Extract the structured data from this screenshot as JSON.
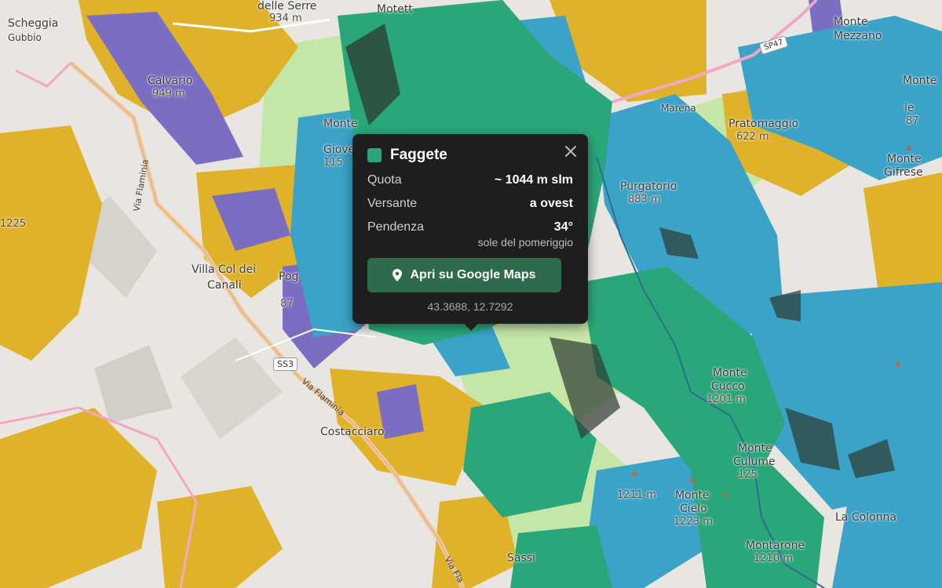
{
  "map": {
    "colors": {
      "base": "#e9e6e1",
      "faggete": "#2aa77a",
      "conifer": "#3aa3c7",
      "meadow": "#c4e6a6",
      "shrub": "#e0b22a",
      "mixed": "#7b6ec2",
      "shadow": "#2d3b33",
      "road_major": "#f0c9a0",
      "road_pink": "#f4a6c8",
      "road_gray": "#ffffff",
      "river": "#2d6e8e"
    },
    "places": [
      {
        "id": "scheggia",
        "text": "Scheggia"
      },
      {
        "id": "gubbio",
        "text": "Gubbio"
      },
      {
        "id": "serre",
        "text": "delle Serre"
      },
      {
        "id": "serre_el",
        "text": "934 m"
      },
      {
        "id": "motett",
        "text": "Motett"
      },
      {
        "id": "monte_mezzano",
        "text": "Monte"
      },
      {
        "id": "monte_mezzano2",
        "text": "Mezzano"
      },
      {
        "id": "calvario",
        "text": "Calvario"
      },
      {
        "id": "calvario_el",
        "text": "949 m"
      },
      {
        "id": "monte_r",
        "text": "Monte"
      },
      {
        "id": "monte_le",
        "text": "le"
      },
      {
        "id": "monte_le_el",
        "text": "87"
      },
      {
        "id": "marena",
        "text": "Marena"
      },
      {
        "id": "pratomaggio",
        "text": "Pratomaggio"
      },
      {
        "id": "pratomaggio_el",
        "text": "622 m"
      },
      {
        "id": "monte_gifrese",
        "text": "Monte"
      },
      {
        "id": "gifrese",
        "text": "Gifrese"
      },
      {
        "id": "monte_giove",
        "text": "Monte"
      },
      {
        "id": "giove",
        "text": "Giove"
      },
      {
        "id": "giove_el",
        "text": "115"
      },
      {
        "id": "purgatorio",
        "text": "Purgatorio"
      },
      {
        "id": "purgatorio_el",
        "text": "883 m"
      },
      {
        "id": "villa",
        "text": "Villa Col dei"
      },
      {
        "id": "villa2",
        "text": "Canali"
      },
      {
        "id": "poggio",
        "text": "Pog"
      },
      {
        "id": "poggio_el",
        "text": "87"
      },
      {
        "id": "costacciaro",
        "text": "Costacciaro"
      },
      {
        "id": "monte_cucco",
        "text": "Monte"
      },
      {
        "id": "cucco2",
        "text": "Cucco"
      },
      {
        "id": "cucco_el",
        "text": "1201 m"
      },
      {
        "id": "monte_culumeo",
        "text": "Monte"
      },
      {
        "id": "culumeo",
        "text": "Culume"
      },
      {
        "id": "culumeo_el",
        "text": "125"
      },
      {
        "id": "monte_cielo",
        "text": "Monte"
      },
      {
        "id": "cielo",
        "text": "Cielo"
      },
      {
        "id": "cielo_el",
        "text": "1223 m"
      },
      {
        "id": "el1211",
        "text": "1211 m"
      },
      {
        "id": "la_colonna",
        "text": "La Colonna"
      },
      {
        "id": "montarone",
        "text": "Montarone"
      },
      {
        "id": "montarone_el",
        "text": "1210 m"
      },
      {
        "id": "el1225",
        "text": "1225"
      },
      {
        "id": "sassi",
        "text": "Sassi"
      }
    ],
    "roads": [
      {
        "id": "ss3",
        "text": "SS3"
      },
      {
        "id": "sp47",
        "text": "SP47"
      },
      {
        "id": "via_flaminia",
        "text": "Via Flaminia"
      },
      {
        "id": "via_flaminia2",
        "text": "Via Flaminia"
      },
      {
        "id": "via_fla3",
        "text": "Via Fla"
      }
    ]
  },
  "popup": {
    "title": "Faggete",
    "swatch_color": "#2aa77a",
    "rows": [
      {
        "label": "Quota",
        "value": "~ 1044 m slm"
      },
      {
        "label": "Versante",
        "value": "a ovest"
      },
      {
        "label": "Pendenza",
        "value": "34°"
      }
    ],
    "pendenza_note": "sole del pomeriggio",
    "maps_button": "Apri su Google Maps",
    "coords": "43.3688, 12.7292",
    "icons": {
      "close": "close-icon",
      "pin": "map-pin-icon"
    }
  }
}
